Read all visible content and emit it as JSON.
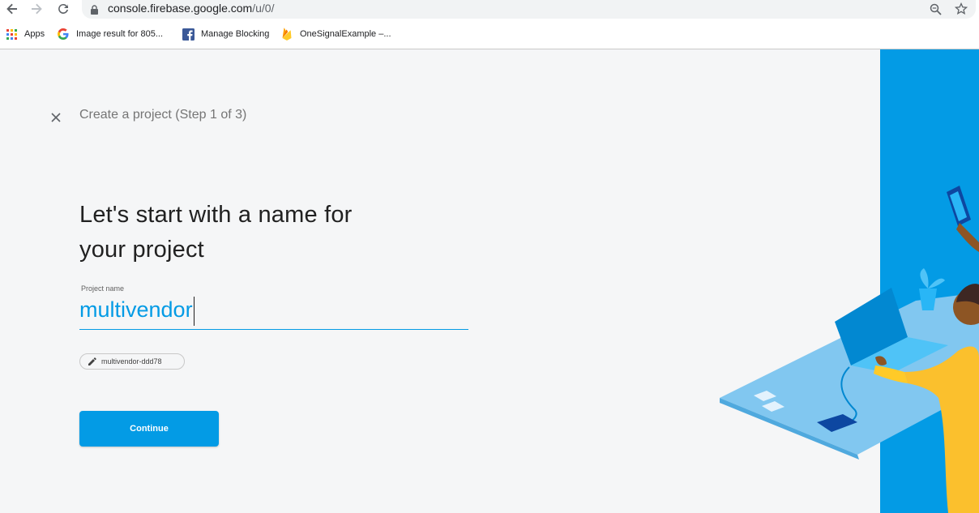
{
  "browser": {
    "url_host": "console.firebase.google.com",
    "url_path": "/u/0/",
    "bookmarks": [
      {
        "label": "Apps",
        "icon": "apps-grid-icon"
      },
      {
        "label": "Image result for 805...",
        "icon": "google-icon"
      },
      {
        "label": "Manage Blocking",
        "icon": "facebook-icon"
      },
      {
        "label": "OneSignalExample –...",
        "icon": "firebase-icon"
      }
    ]
  },
  "page": {
    "step_label": "Create a project (Step 1 of 3)",
    "heading_line1": "Let's start with a name for",
    "heading_line2": "your project",
    "field_label": "Project name",
    "field_value": "multivendor",
    "project_id": "multivendor-ddd78",
    "continue_label": "Continue"
  },
  "colors": {
    "accent": "#039be5",
    "illustration_blue": "#039be5",
    "illustration_yellow": "#ffca28"
  }
}
